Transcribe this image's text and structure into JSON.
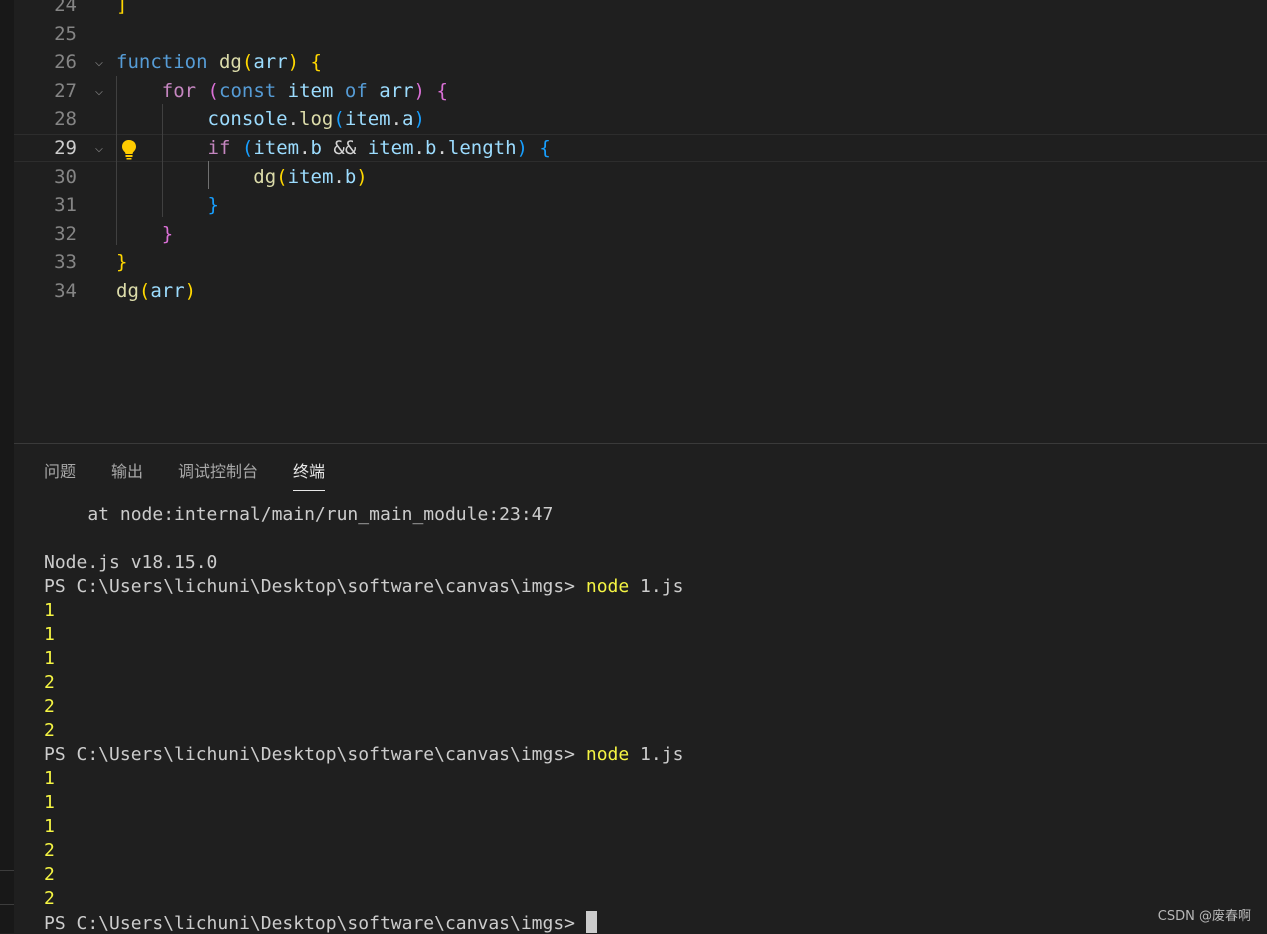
{
  "editor": {
    "lines": [
      {
        "n": "24",
        "parts": [
          {
            "t": "]",
            "c": "t-b1"
          }
        ]
      },
      {
        "n": "25",
        "parts": []
      },
      {
        "n": "26",
        "parts": [
          {
            "t": "function",
            "c": "t-kw"
          },
          {
            "t": " ",
            "c": "t-plain"
          },
          {
            "t": "dg",
            "c": "t-fn"
          },
          {
            "t": "(",
            "c": "t-b1"
          },
          {
            "t": "arr",
            "c": "t-var"
          },
          {
            "t": ")",
            "c": "t-b1"
          },
          {
            "t": " ",
            "c": "t-plain"
          },
          {
            "t": "{",
            "c": "t-b1"
          }
        ]
      },
      {
        "n": "27",
        "parts": [
          {
            "t": "    ",
            "c": "t-plain"
          },
          {
            "t": "for",
            "c": "t-ctrl"
          },
          {
            "t": " ",
            "c": "t-plain"
          },
          {
            "t": "(",
            "c": "t-b2"
          },
          {
            "t": "const",
            "c": "t-kw"
          },
          {
            "t": " ",
            "c": "t-plain"
          },
          {
            "t": "item",
            "c": "t-var"
          },
          {
            "t": " ",
            "c": "t-plain"
          },
          {
            "t": "of",
            "c": "t-kw"
          },
          {
            "t": " ",
            "c": "t-plain"
          },
          {
            "t": "arr",
            "c": "t-var"
          },
          {
            "t": ")",
            "c": "t-b2"
          },
          {
            "t": " ",
            "c": "t-plain"
          },
          {
            "t": "{",
            "c": "t-b2"
          }
        ]
      },
      {
        "n": "28",
        "parts": [
          {
            "t": "        ",
            "c": "t-plain"
          },
          {
            "t": "console",
            "c": "t-var"
          },
          {
            "t": ".",
            "c": "t-plain"
          },
          {
            "t": "log",
            "c": "t-fn"
          },
          {
            "t": "(",
            "c": "t-b3"
          },
          {
            "t": "item",
            "c": "t-var"
          },
          {
            "t": ".",
            "c": "t-plain"
          },
          {
            "t": "a",
            "c": "t-var"
          },
          {
            "t": ")",
            "c": "t-b3"
          }
        ]
      },
      {
        "n": "29",
        "parts": [
          {
            "t": "        ",
            "c": "t-plain"
          },
          {
            "t": "if",
            "c": "t-ctrl"
          },
          {
            "t": " ",
            "c": "t-plain"
          },
          {
            "t": "(",
            "c": "t-b3"
          },
          {
            "t": "item",
            "c": "t-var"
          },
          {
            "t": ".",
            "c": "t-plain"
          },
          {
            "t": "b",
            "c": "t-var"
          },
          {
            "t": " && ",
            "c": "t-plain"
          },
          {
            "t": "item",
            "c": "t-var"
          },
          {
            "t": ".",
            "c": "t-plain"
          },
          {
            "t": "b",
            "c": "t-var"
          },
          {
            "t": ".",
            "c": "t-plain"
          },
          {
            "t": "length",
            "c": "t-var"
          },
          {
            "t": ")",
            "c": "t-b3"
          },
          {
            "t": " ",
            "c": "t-plain"
          },
          {
            "t": "{",
            "c": "t-b3"
          }
        ]
      },
      {
        "n": "30",
        "parts": [
          {
            "t": "            ",
            "c": "t-plain"
          },
          {
            "t": "dg",
            "c": "t-fn"
          },
          {
            "t": "(",
            "c": "t-b1"
          },
          {
            "t": "item",
            "c": "t-var"
          },
          {
            "t": ".",
            "c": "t-plain"
          },
          {
            "t": "b",
            "c": "t-var"
          },
          {
            "t": ")",
            "c": "t-b1"
          }
        ]
      },
      {
        "n": "31",
        "parts": [
          {
            "t": "        ",
            "c": "t-plain"
          },
          {
            "t": "}",
            "c": "t-b3"
          }
        ]
      },
      {
        "n": "32",
        "parts": [
          {
            "t": "    ",
            "c": "t-plain"
          },
          {
            "t": "}",
            "c": "t-b2"
          }
        ]
      },
      {
        "n": "33",
        "parts": [
          {
            "t": "}",
            "c": "t-b1"
          }
        ]
      },
      {
        "n": "34",
        "parts": [
          {
            "t": "dg",
            "c": "t-fn"
          },
          {
            "t": "(",
            "c": "t-b1"
          },
          {
            "t": "arr",
            "c": "t-var"
          },
          {
            "t": ")",
            "c": "t-b1"
          }
        ]
      }
    ],
    "active_line": "29",
    "fold_lines": [
      "26",
      "27",
      "29"
    ]
  },
  "panel": {
    "tabs": [
      "问题",
      "输出",
      "调试控制台",
      "终端"
    ],
    "active_tab": "终端"
  },
  "terminal": {
    "lines": [
      {
        "text": "    at node:internal/main/run_main_module:23:47",
        "kind": "text"
      },
      {
        "text": "",
        "kind": "text"
      },
      {
        "text": "Node.js v18.15.0",
        "kind": "text"
      },
      {
        "text": "PS C:\\Users\\lichuni\\Desktop\\software\\canvas\\imgs> ",
        "cmd": "node",
        "arg": " 1.js",
        "kind": "prompt"
      },
      {
        "text": "1",
        "kind": "num"
      },
      {
        "text": "1",
        "kind": "num"
      },
      {
        "text": "1",
        "kind": "num"
      },
      {
        "text": "2",
        "kind": "num"
      },
      {
        "text": "2",
        "kind": "num"
      },
      {
        "text": "2",
        "kind": "num"
      },
      {
        "text": "PS C:\\Users\\lichuni\\Desktop\\software\\canvas\\imgs> ",
        "cmd": "node",
        "arg": " 1.js",
        "kind": "prompt"
      },
      {
        "text": "1",
        "kind": "num"
      },
      {
        "text": "1",
        "kind": "num"
      },
      {
        "text": "1",
        "kind": "num"
      },
      {
        "text": "2",
        "kind": "num"
      },
      {
        "text": "2",
        "kind": "num"
      },
      {
        "text": "2",
        "kind": "num"
      },
      {
        "text": "PS C:\\Users\\lichuni\\Desktop\\software\\canvas\\imgs> ",
        "kind": "cursor"
      }
    ]
  },
  "watermark": "CSDN @废春啊"
}
